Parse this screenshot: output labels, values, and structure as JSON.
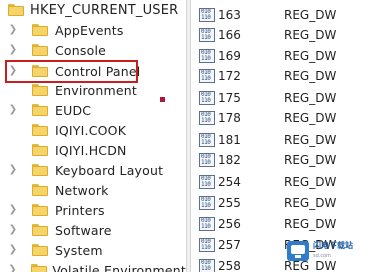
{
  "tree": {
    "root_label": "HKEY_CURRENT_USER",
    "items": [
      {
        "label": "AppEvents"
      },
      {
        "label": "Console"
      },
      {
        "label": "Control Panel",
        "highlighted": true
      },
      {
        "label": "Environment"
      },
      {
        "label": "EUDC"
      },
      {
        "label": "IQIYI.COOK"
      },
      {
        "label": "IQIYI.HCDN"
      },
      {
        "label": "Keyboard Layout"
      },
      {
        "label": "Network"
      },
      {
        "label": "Printers"
      },
      {
        "label": "Software"
      },
      {
        "label": "System"
      },
      {
        "label": "Volatile Environment"
      }
    ],
    "highlight_color": "#c81e1e"
  },
  "values": {
    "rows": [
      {
        "name": "163",
        "type": "REG_DW"
      },
      {
        "name": "166",
        "type": "REG_DW"
      },
      {
        "name": "169",
        "type": "REG_DW"
      },
      {
        "name": "172",
        "type": "REG_DW"
      },
      {
        "name": "175",
        "type": "REG_DW"
      },
      {
        "name": "178",
        "type": "REG_DW"
      },
      {
        "name": "181",
        "type": "REG_DW"
      },
      {
        "name": "182",
        "type": "REG_DW"
      },
      {
        "name": "254",
        "type": "REG_DW"
      },
      {
        "name": "255",
        "type": "REG_DW"
      },
      {
        "name": "256",
        "type": "REG_DW"
      },
      {
        "name": "257",
        "type": "REG_DW"
      },
      {
        "name": "258",
        "type": "REG_DW"
      }
    ],
    "icon": "binary-value-icon"
  },
  "watermark": {
    "text": "闪电下载站",
    "sub": "sd.com"
  }
}
